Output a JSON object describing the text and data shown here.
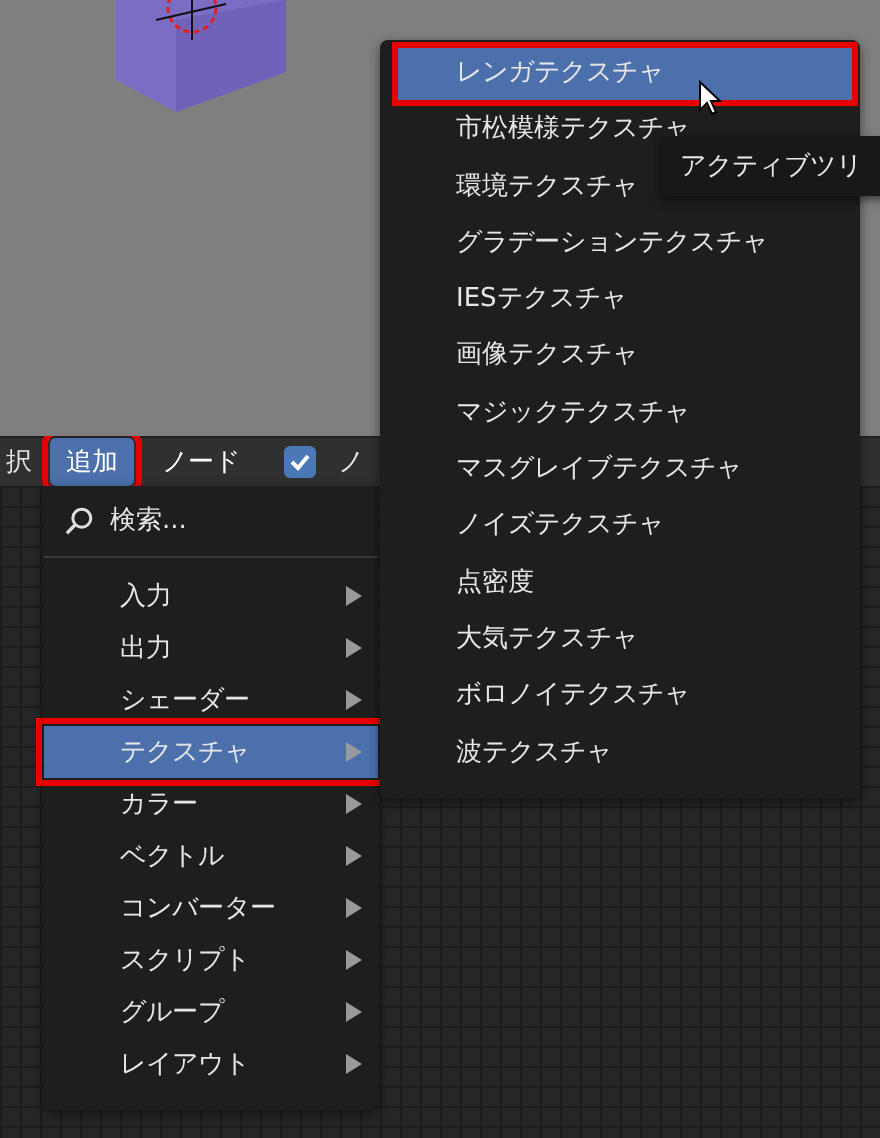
{
  "header": {
    "items": [
      {
        "kind": "text",
        "label": "択"
      },
      {
        "kind": "menu",
        "label": "追加",
        "selected": true
      },
      {
        "kind": "menu",
        "label": "ノード",
        "selected": false
      },
      {
        "kind": "checkbox",
        "label": "ノ",
        "checked": true
      }
    ]
  },
  "add_menu": {
    "search": "検索...",
    "items": [
      {
        "label": "入力",
        "selected": false
      },
      {
        "label": "出力",
        "selected": false
      },
      {
        "label": "シェーダー",
        "selected": false
      },
      {
        "label": "テクスチャ",
        "selected": true
      },
      {
        "label": "カラー",
        "selected": false
      },
      {
        "label": "ベクトル",
        "selected": false
      },
      {
        "label": "コンバーター",
        "selected": false
      },
      {
        "label": "スクリプト",
        "selected": false
      },
      {
        "label": "グループ",
        "selected": false
      },
      {
        "label": "レイアウト",
        "selected": false
      }
    ]
  },
  "texture_menu": {
    "items": [
      {
        "label": "レンガテクスチャ",
        "selected": true
      },
      {
        "label": "市松模様テクスチャ",
        "selected": false
      },
      {
        "label": "環境テクスチャ",
        "selected": false
      },
      {
        "label": "グラデーションテクスチャ",
        "selected": false
      },
      {
        "label": "IESテクスチャ",
        "selected": false
      },
      {
        "label": "画像テクスチャ",
        "selected": false
      },
      {
        "label": "マジックテクスチャ",
        "selected": false
      },
      {
        "label": "マスグレイブテクスチャ",
        "selected": false
      },
      {
        "label": "ノイズテクスチャ",
        "selected": false
      },
      {
        "label": "点密度",
        "selected": false
      },
      {
        "label": "大気テクスチャ",
        "selected": false
      },
      {
        "label": "ボロノイテクスチャ",
        "selected": false
      },
      {
        "label": "波テクスチャ",
        "selected": false
      }
    ]
  },
  "tooltip": "アクティブツリ"
}
